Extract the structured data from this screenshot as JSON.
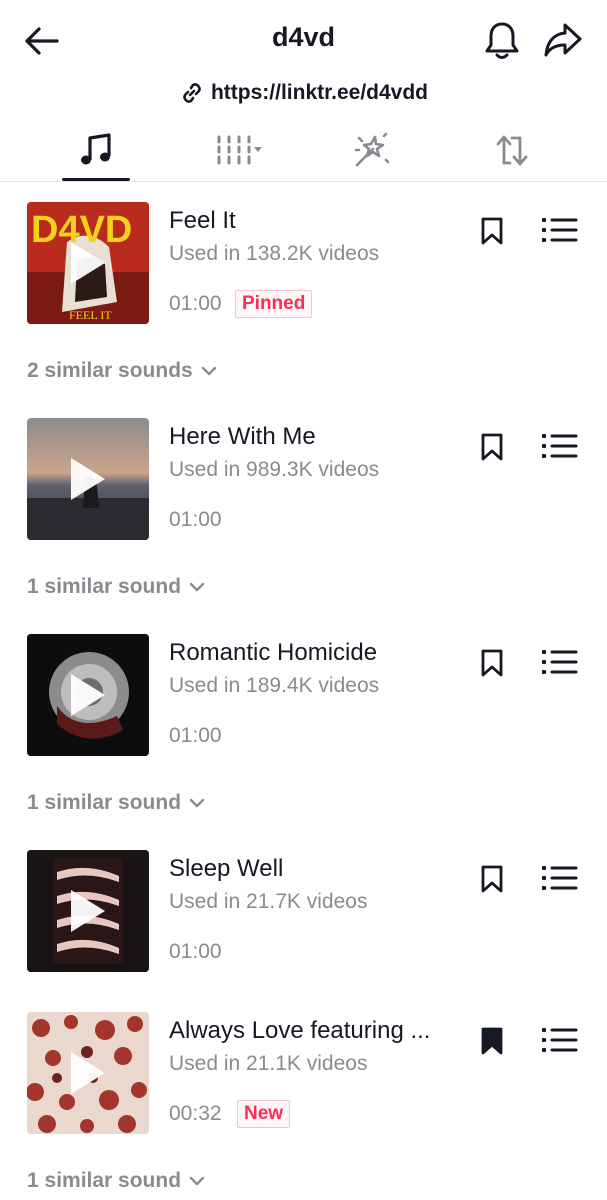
{
  "header": {
    "title": "d4vd",
    "link": "https://linktr.ee/d4vdd"
  },
  "tabs": [
    {
      "icon": "music-note-icon",
      "active": true
    },
    {
      "icon": "playlist-grid-icon",
      "active": false
    },
    {
      "icon": "effect-wand-icon",
      "active": false
    },
    {
      "icon": "repost-icon",
      "active": false
    }
  ],
  "sounds": [
    {
      "title": "Feel It",
      "uses": "Used in 138.2K videos",
      "duration": "01:00",
      "badge": "Pinned",
      "bookmarked": false,
      "cover_text": "D4VD",
      "cover_caption": "FEEL IT"
    },
    {
      "title": "Here With Me",
      "uses": "Used in 989.3K videos",
      "duration": "01:00",
      "badge": "",
      "bookmarked": false
    },
    {
      "title": "Romantic Homicide",
      "uses": "Used in 189.4K videos",
      "duration": "01:00",
      "badge": "",
      "bookmarked": false
    },
    {
      "title": "Sleep Well",
      "uses": "Used in 21.7K videos",
      "duration": "01:00",
      "badge": "",
      "bookmarked": false
    },
    {
      "title": "Always Love featuring ...",
      "uses": "Used in 21.1K videos",
      "duration": "00:32",
      "badge": "New",
      "bookmarked": true
    }
  ],
  "similar": [
    "2 similar sounds",
    "1 similar sound",
    "1 similar sound",
    "1 similar sound"
  ],
  "colors": {
    "accent": "#fe2c55",
    "text": "#161823",
    "secondary": "#8a8b91"
  }
}
